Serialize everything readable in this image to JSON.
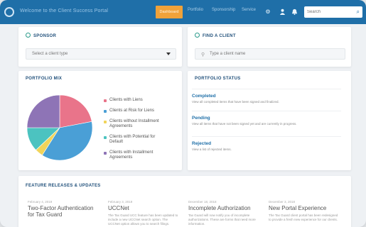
{
  "topbar": {
    "app_title": "Welcome to the Client Success Portal",
    "nav": [
      "Dashboard",
      "Portfolio",
      "Sponsorship",
      "Service"
    ],
    "active_nav": "Dashboard",
    "search_placeholder": "Search"
  },
  "sponsor_card": {
    "title": "SPONSOR",
    "select_value": "Select a client type"
  },
  "find_client_card": {
    "title": "FIND A CLIENT",
    "input_placeholder": "Type a client name"
  },
  "portfolio_mix": {
    "title": "PORTFOLIO MIX"
  },
  "portfolio_status": {
    "title": "PORTFOLIO STATUS",
    "items": [
      {
        "title": "Completed",
        "desc": "View all completed items that have been signed and finalized."
      },
      {
        "title": "Pending",
        "desc": "View all items that have not been signed yet and are currently in progress."
      },
      {
        "title": "Rejected",
        "desc": "View a list of rejected items."
      }
    ]
  },
  "features": {
    "title": "FEATURE RELEASES & UPDATES",
    "items": [
      {
        "date": "February 4, 2019",
        "title": "Two-Factor Authentication for Tax Guard",
        "desc": ""
      },
      {
        "date": "February 3, 2019",
        "title": "UCCNet",
        "desc": "The Tax Guard UCC feature has been updated to include a new UCCNet search option. The UCCNet option allows you to search filings."
      },
      {
        "date": "December 18, 2018",
        "title": "Incomplete Authorization",
        "desc": "Tax Guard will now notify you of incomplete authorizations. These are forms that need more information."
      },
      {
        "date": "December 3, 2018",
        "title": "New Portal Experience",
        "desc": "The Tax Guard client portal has been redesigned to provide a fresh new experience for our clients."
      }
    ]
  },
  "chart_data": {
    "type": "pie",
    "title": "PORTFOLIO MIX",
    "series": [
      {
        "name": "Clients with Liens",
        "value": 22,
        "color": "#e9748a"
      },
      {
        "name": "Clients at Risk for Liens",
        "value": 37,
        "color": "#4a9fd6"
      },
      {
        "name": "Clients without Installment Agreements",
        "value": 4,
        "color": "#f1d45a"
      },
      {
        "name": "Clients with Potential for Default",
        "value": 12,
        "color": "#4cc3c0"
      },
      {
        "name": "Clients with Installment Agreements",
        "value": 25,
        "color": "#8e74b6"
      }
    ]
  }
}
